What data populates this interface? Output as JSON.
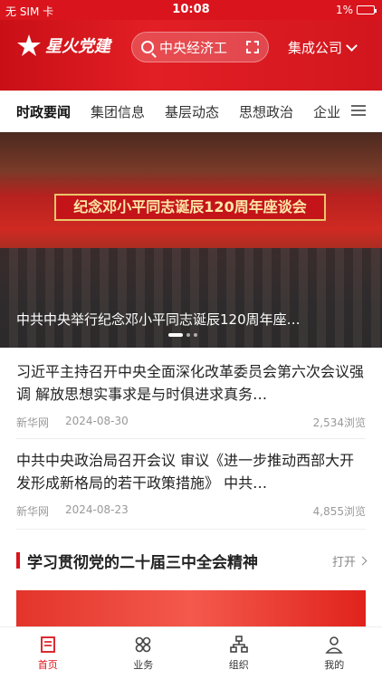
{
  "status_bar": {
    "carrier": "无 SIM 卡",
    "time": "10:08",
    "battery": "1%"
  },
  "header": {
    "app_name": "星火党建",
    "search_value": "中央经济工",
    "company_selector": "集成公司"
  },
  "tabs": [
    {
      "label": "时政要闻",
      "active": true
    },
    {
      "label": "集团信息",
      "active": false
    },
    {
      "label": "基层动态",
      "active": false
    },
    {
      "label": "思想政治",
      "active": false
    },
    {
      "label": "企业",
      "active": false
    }
  ],
  "banner": {
    "stage_text": "纪念邓小平同志诞辰120周年座谈会",
    "caption": "中共中央举行纪念邓小平同志诞辰120周年座…"
  },
  "news": [
    {
      "title": "习近平主持召开中央全面深化改革委员会第六次会议强调 解放思想实事求是与时俱进求真务…",
      "source": "新华网",
      "date": "2024-08-30",
      "views": "2,534浏览"
    },
    {
      "title": "中共中央政治局召开会议 审议《进一步推动西部大开发形成新格局的若干政策措施》 中共…",
      "source": "新华网",
      "date": "2024-08-23",
      "views": "4,855浏览"
    }
  ],
  "section": {
    "title": "学习贯彻党的二十届三中全会精神",
    "open_label": "打开"
  },
  "bottom_nav": [
    {
      "label": "首页",
      "icon": "home-icon",
      "active": true
    },
    {
      "label": "业务",
      "icon": "apps-icon",
      "active": false
    },
    {
      "label": "组织",
      "icon": "org-icon",
      "active": false
    },
    {
      "label": "我的",
      "icon": "profile-icon",
      "active": false
    }
  ],
  "colors": {
    "accent": "#d9141c"
  }
}
